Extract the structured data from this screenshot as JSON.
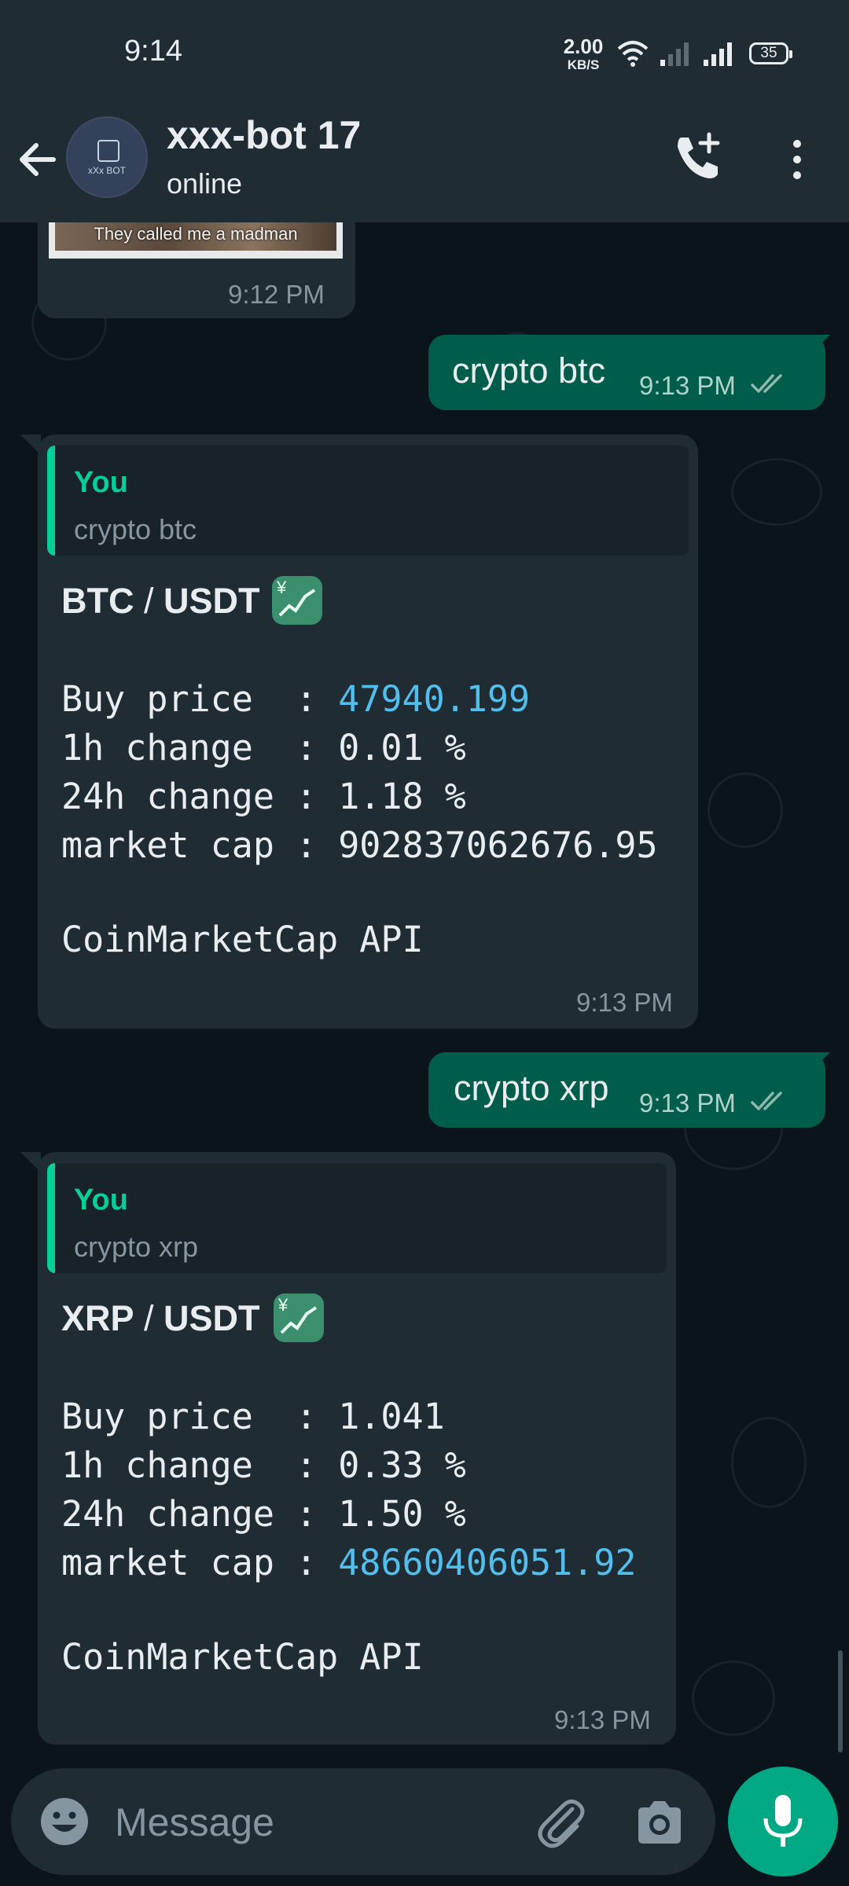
{
  "status_bar": {
    "time": "9:14",
    "net_speed_value": "2.00",
    "net_speed_unit": "KB/S",
    "battery": "35"
  },
  "header": {
    "title": "xxx-bot 17",
    "subtitle": "online",
    "avatar_text": "xXx BOT"
  },
  "messages": [
    {
      "image_caption": "They called me a madman",
      "time": "9:12 PM"
    },
    {
      "text": "crypto btc",
      "time": "9:13 PM"
    },
    {
      "quote_author": "You",
      "quote_text": "crypto btc",
      "pair_base": "BTC",
      "pair_sep": " / ",
      "pair_quote": "USDT",
      "rows": [
        {
          "label": "Buy price  : ",
          "value": "47940.199"
        },
        {
          "label": "1h change  : ",
          "value": "0.01 %"
        },
        {
          "label": "24h change : ",
          "value": "1.18 %"
        },
        {
          "label": "market cap : ",
          "value": "902837062676.95"
        }
      ],
      "source": "CoinMarketCap API",
      "time": "9:13 PM"
    },
    {
      "text": "crypto xrp",
      "time": "9:13 PM"
    },
    {
      "quote_author": "You",
      "quote_text": "crypto xrp",
      "pair_base": "XRP",
      "pair_sep": " / ",
      "pair_quote": "USDT",
      "rows": [
        {
          "label": "Buy price  : ",
          "value": "1.041"
        },
        {
          "label": "1h change  : ",
          "value": "0.33 %"
        },
        {
          "label": "24h change : ",
          "value": "1.50 %"
        },
        {
          "label": "market cap : ",
          "value": "48660406051.92"
        }
      ],
      "source": "CoinMarketCap API",
      "time": "9:13 PM"
    }
  ],
  "input": {
    "placeholder": "Message"
  },
  "colors": {
    "background": "#0b141a",
    "bar": "#1f2c34",
    "outgoing": "#005c4b",
    "accent": "#00a884",
    "link": "#53bdeb"
  }
}
